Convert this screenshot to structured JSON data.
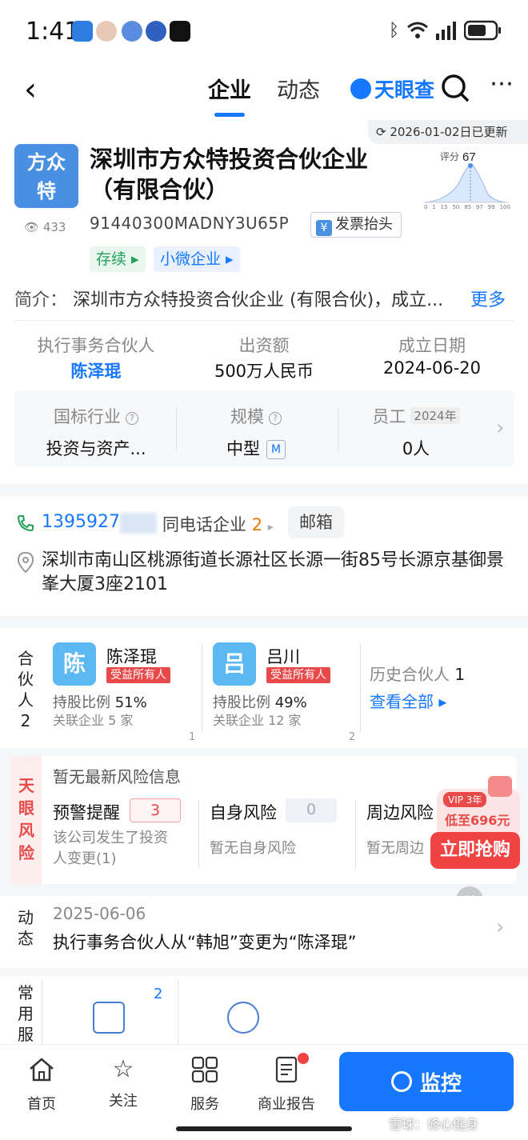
{
  "status_bar": {
    "time": "1:41",
    "battery_icon": "battery-icon",
    "wifi_icon": "wifi-icon",
    "signal_icon": "signal-icon"
  },
  "nav": {
    "tabs": [
      {
        "label": "企业",
        "active": true
      },
      {
        "label": "动态",
        "active": false
      }
    ],
    "brand": "天眼查",
    "accent": "#1677ff"
  },
  "header": {
    "updated": "2026-01-02日已更新",
    "logo_text_line1": "方众",
    "logo_text_line2": "特",
    "company_name": "深圳市方众特投资合伙企业（有限合伙）",
    "views": "433",
    "credit_code": "91440300MADNY3U65P",
    "invoice_button": "发票抬头",
    "tags": [
      "存续",
      "小微企业"
    ],
    "score_label": "评分",
    "score_value": "67",
    "score_axis": [
      "0",
      "1",
      "15",
      "50",
      "85",
      "97",
      "99",
      "100"
    ],
    "intro_label": "简介：",
    "intro_text": "深圳市方众特投资合伙企业 (有限合伙)，成立...",
    "intro_more": "更多"
  },
  "key_info": [
    {
      "label": "执行事务合伙人",
      "value": "陈泽琨"
    },
    {
      "label": "出资额",
      "value": "500万人民币"
    },
    {
      "label": "成立日期",
      "value": "2024-06-20"
    }
  ],
  "industry_panel": [
    {
      "label": "国标行业",
      "value": "投资与资产..."
    },
    {
      "label": "规模",
      "value": "中型",
      "badge": "M"
    },
    {
      "label": "员工",
      "year": "2024年",
      "value": "0人"
    }
  ],
  "contact": {
    "phone": "1395927",
    "same_phone_label": "同电话企业",
    "same_phone_count": "2",
    "email": "邮箱",
    "address": "深圳市南山区桃源街道长源社区长源一街85号长源京基御景峯大厦3座2101"
  },
  "partners": {
    "section_label": "合伙人",
    "section_count": "2",
    "items": [
      {
        "avatar": "陈",
        "name": "陈泽琨",
        "tag": "受益所有人",
        "share_label": "持股比例",
        "share": "51%",
        "related_label": "关联企业",
        "related": "5 家",
        "index": "1"
      },
      {
        "avatar": "吕",
        "name": "吕川",
        "tag": "受益所有人",
        "share_label": "持股比例",
        "share": "49%",
        "related_label": "关联企业",
        "related": "12 家",
        "index": "2"
      }
    ],
    "history_label": "历史合伙人",
    "history_count": "1",
    "view_all": "查看全部"
  },
  "risk": {
    "side_label": "天眼风险",
    "title": "暂无最新风险信息",
    "cols": [
      {
        "title": "预警提醒",
        "count": "3",
        "desc_line1": "该公司发生了投资",
        "desc_line2": "人变更(1)"
      },
      {
        "title": "自身风险",
        "count": "0",
        "desc_line1": "暂无自身风险",
        "desc_line2": ""
      },
      {
        "title": "周边风险",
        "count": "",
        "desc_line1": "暂无周边",
        "desc_line2": ""
      }
    ]
  },
  "promo": {
    "vip": "VIP 3年",
    "price": "低至696元",
    "button": "立即抢购"
  },
  "news": {
    "label": "动态",
    "date": "2025-06-06",
    "text": "执行事务合伙人从“韩旭”变更为“陈泽琨”"
  },
  "services": {
    "label": "常用服",
    "badge": "2"
  },
  "bottom_bar": {
    "items": [
      {
        "label": "首页",
        "icon": "home-icon"
      },
      {
        "label": "关注",
        "icon": "star-icon"
      },
      {
        "label": "服务",
        "icon": "grid-icon"
      },
      {
        "label": "商业报告",
        "icon": "report-icon"
      }
    ],
    "monitor": "监控"
  },
  "watermark": "雪球：修心健身"
}
